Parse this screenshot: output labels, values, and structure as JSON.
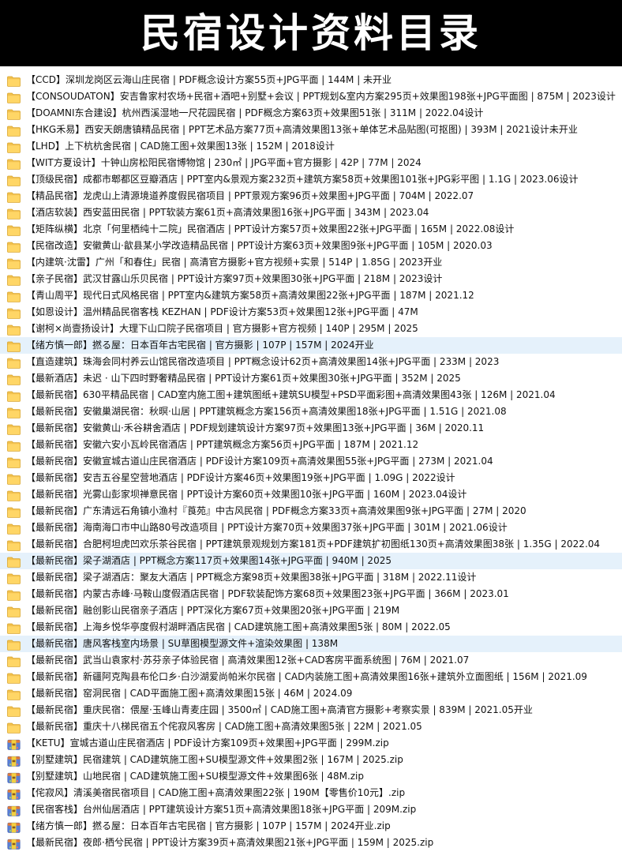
{
  "title": "民宿设计资料目录",
  "items": [
    {
      "type": "folder",
      "label": "【CCD】深圳龙岗区云海山庄民宿 | PDF概念设计方案55页+JPG平面 | 144M | 未开业"
    },
    {
      "type": "folder",
      "label": "【CONSOUDATON】安吉鲁家村农场+民宿+酒吧+别墅+会议 | PPT规划&室内方案295页+效果图198张+JPG平面图 | 875M | 2023设计"
    },
    {
      "type": "folder",
      "label": "【DOAMNI东合建设】杭州西溪湿地一尺花园民宿 | PDF概念方案63页+效果图51张 | 311M | 2022.04设计"
    },
    {
      "type": "folder",
      "label": "【HKG禾易】西安天朗唐镇精品民宿 | PPT艺术品方案77页+高清效果图13张+单体艺术品贴图(可抠图) | 393M | 2021设计未开业"
    },
    {
      "type": "folder",
      "label": "【LHD】上下杭杭舍民宿 | CAD施工图+效果图13张 | 152M | 2018设计"
    },
    {
      "type": "folder",
      "label": "【WIT方夏设计】十钟山房松阳民宿博物馆 | 230㎡ | JPG平面+官方摄影 | 42P | 77M | 2024"
    },
    {
      "type": "folder",
      "label": "【顶级民宿】成都市郫都区豆瓣酒店 | PPT室内&景观方案232页+建筑方案58页+效果图101张+JPG彩平图 | 1.1G | 2023.06设计"
    },
    {
      "type": "folder",
      "label": "【精品民宿】龙虎山上清源境道养度假民宿项目 | PPT景观方案96页+效果图+JPG平面 | 704M | 2022.07"
    },
    {
      "type": "folder",
      "label": "【酒店软装】西安蓝田民宿 | PPT软装方案61页+高清效果图16张+JPG平面 | 343M | 2023.04"
    },
    {
      "type": "folder",
      "label": "【矩阵纵横】北京「何里栖纯十二院」民宿酒店 | PPT设计方案57页+效果图22张+JPG平面 | 165M | 2022.08设计"
    },
    {
      "type": "folder",
      "label": "【民宿改造】安徽黄山·歙县某小学改造精品民宿 | PPT设计方案63页+效果图9张+JPG平面 | 105M | 2020.03"
    },
    {
      "type": "folder",
      "label": "【内建筑·沈雷】广州「和春住」民宿 | 高清官方摄影+官方视频+实景 | 514P | 1.85G | 2023开业"
    },
    {
      "type": "folder",
      "label": "【亲子民宿】武汉甘露山乐贝民宿 | PPT设计方案97页+效果图30张+JPG平面 | 218M | 2023设计"
    },
    {
      "type": "folder",
      "label": "【青山周平】现代日式风格民宿 | PPT室内&建筑方案58页+高清效果图22张+JPG平面 | 187M | 2021.12"
    },
    {
      "type": "folder",
      "label": "【如恩设计】温州精品民宿客栈 KEZHAN | PDF设计方案53页+效果图12张+JPG平面 | 47M"
    },
    {
      "type": "folder",
      "label": "【谢柯×尚壹扬设计】大理下山口院子民宿项目 | 官方摄影+官方视频 | 140P | 295M | 2025"
    },
    {
      "type": "folder",
      "label": "【绪方慎一郎】撚る屋：日本百年古宅民宿 | 官方摄影 | 107P | 157M | 2024开业",
      "selected": true
    },
    {
      "type": "folder",
      "label": "【直造建筑】珠海会同村养云山馆民宿改造项目 | PPT概念设计62页+高清效果图14张+JPG平面 | 233M | 2023"
    },
    {
      "type": "folder",
      "label": "【最新酒店】未迟 · 山下四时野奢精品民宿 | PPT设计方案61页+效果图30张+JPG平面 | 352M | 2025"
    },
    {
      "type": "folder",
      "label": "【最新民宿】630平精品民宿 | CAD室内施工图+建筑图纸+建筑SU模型+PSD平面彩图+高清效果图43张 | 126M | 2021.04"
    },
    {
      "type": "folder",
      "label": "【最新民宿】安徽巢湖民宿：秋暝·山居 | PPT建筑概念方案156页+高清效果图18张+JPG平面 | 1.51G | 2021.08"
    },
    {
      "type": "folder",
      "label": "【最新民宿】安徽黄山·禾谷耕舍酒店 | PDF规划建筑设计方案97页+效果图13张+JPG平面 | 36M | 2020.11"
    },
    {
      "type": "folder",
      "label": "【最新民宿】安徽六安小瓦岭民宿酒店 | PPT建筑概念方案56页+JPG平面 | 187M | 2021.12"
    },
    {
      "type": "folder",
      "label": "【最新民宿】安徽宣城古道山庄民宿酒店 | PDF设计方案109页+高清效果图55张+JPG平面 | 273M | 2021.04"
    },
    {
      "type": "folder",
      "label": "【最新民宿】安吉五谷星空营地酒店 | PDF设计方案46页+效果图19张+JPG平面 | 1.09G | 2022设计"
    },
    {
      "type": "folder",
      "label": "【最新民宿】光雾山彭家坝禅意民宿 | PPT设计方案60页+效果图10张+JPG平面 | 160M | 2023.04设计"
    },
    {
      "type": "folder",
      "label": "【最新民宿】广东清远石角镇小渔村『莨苑』中古风民宿 | PDF概念方案33页+高清效果图9张+JPG平面 | 27M | 2020"
    },
    {
      "type": "folder",
      "label": "【最新民宿】海南海口市中山路80号改造项目 | PPT设计方案70页+效果图37张+JPG平面 | 301M | 2021.06设计"
    },
    {
      "type": "folder",
      "label": "【最新民宿】合肥柯坦虎凹欢乐茶谷民宿 | PPT建筑景观规划方案181页+PDF建筑扩初图纸130页+高清效果图38张 | 1.35G | 2022.04"
    },
    {
      "type": "folder",
      "label": "【最新民宿】梁子湖酒店 | PPT概念方案117页+效果图14张+JPG平面 | 940M | 2025",
      "selected": true
    },
    {
      "type": "folder",
      "label": "【最新民宿】梁子湖酒店：聚友大酒店 | PPT概念方案98页+效果图38张+JPG平面 | 318M | 2022.11设计"
    },
    {
      "type": "folder",
      "label": "【最新民宿】内蒙古赤峰·马鞍山度假酒店民宿 | PDF软装配饰方案68页+效果图23张+JPG平面 | 366M | 2023.01"
    },
    {
      "type": "folder",
      "label": "【最新民宿】融创影山民宿亲子酒店 | PPT深化方案67页+效果图20张+JPG平面 | 219M"
    },
    {
      "type": "folder",
      "label": "【最新民宿】上海乡悦华亭度假村湖畔酒店民宿 | CAD建筑施工图+高清效果图5张 | 80M | 2022.05"
    },
    {
      "type": "folder",
      "label": "【最新民宿】唐风客栈室内场景 | SU草图模型源文件+渲染效果图 | 138M",
      "selected": true
    },
    {
      "type": "folder",
      "label": "【最新民宿】武当山袁家村·苏芬亲子体验民宿 | 高清效果图12张+CAD客房平面系统图 | 76M | 2021.07"
    },
    {
      "type": "folder",
      "label": "【最新民宿】新疆阿克陶县布伦口乡·白沙湖爱尚帕米尔民宿 | CAD内装施工图+高清效果图16张+建筑外立面图纸 | 156M | 2021.09"
    },
    {
      "type": "folder",
      "label": "【最新民宿】窑洞民宿 | CAD平面施工图+高清效果图15张 | 46M | 2024.09"
    },
    {
      "type": "folder",
      "label": "【最新民宿】重庆民宿：偎屋·玉峰山青麦庄园 | 3500㎡ | CAD施工图+高清官方摄影+考察实景 | 839M | 2021.05开业"
    },
    {
      "type": "folder",
      "label": "【最新民宿】重庆十八梯民宿五个侘寂风客房 | CAD施工图+高清效果图5张 | 22M | 2021.05"
    },
    {
      "type": "archive",
      "label": "【KETU】宣城古道山庄民宿酒店 | PDF设计方案109页+效果图+JPG平面 | 299M.zip"
    },
    {
      "type": "archive",
      "label": "【别墅建筑】民宿建筑 | CAD建筑施工图+SU模型源文件+效果图2张 | 167M | 2025.zip"
    },
    {
      "type": "archive",
      "label": "【别墅建筑】山地民宿 | CAD建筑施工图+SU模型源文件+效果图6张 | 48M.zip"
    },
    {
      "type": "archive",
      "label": "【侘寂风】清溪美宿民宿项目 | CAD施工图+高清效果图22张 | 190M【零售价10元】.zip"
    },
    {
      "type": "archive",
      "label": "【民宿客栈】台州仙居酒店 | PPT建筑设计方案51页+高清效果图18张+JPG平面 | 209M.zip"
    },
    {
      "type": "archive",
      "label": "【绪方慎一郎】撚る屋：日本百年古宅民宿 | 官方摄影 | 107P | 157M | 2024开业.zip"
    },
    {
      "type": "archive",
      "label": "【最新民宿】夜郎·栖兮民宿 | PPT设计方案39页+高清效果图21张+JPG平面 | 159M | 2025.zip"
    }
  ]
}
